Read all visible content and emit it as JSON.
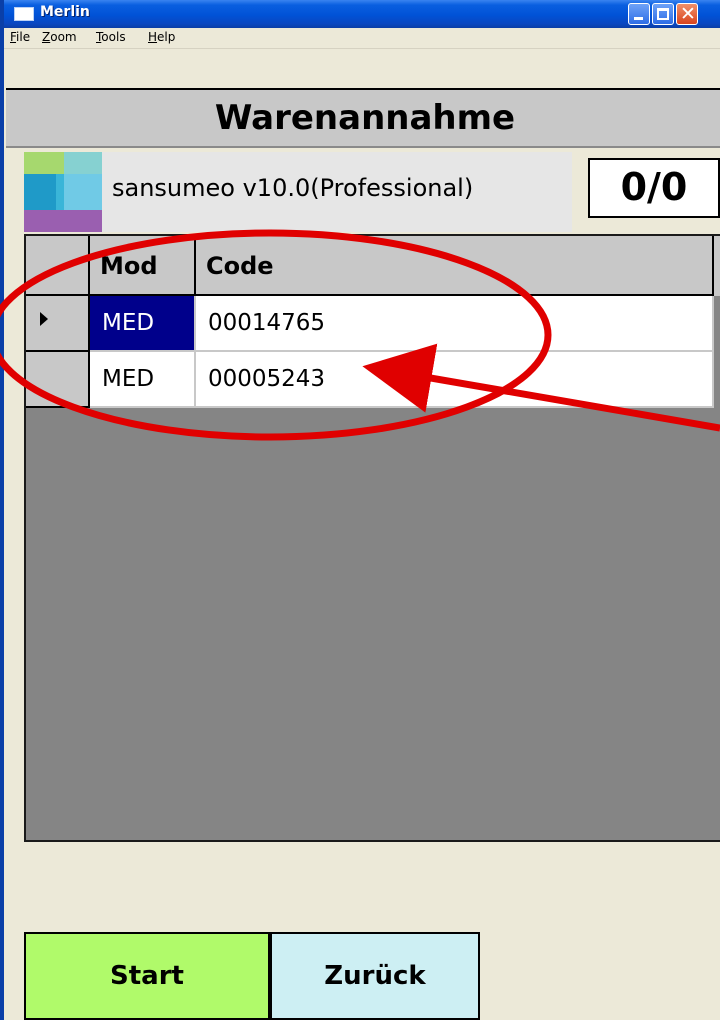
{
  "window": {
    "title": "Merlin",
    "controls": [
      "minimize-icon",
      "maximize-icon",
      "close-icon"
    ]
  },
  "menu": {
    "file": {
      "hotkey": "F",
      "rest": "ile"
    },
    "zoom": {
      "hotkey": "Z",
      "rest": "oom"
    },
    "tools": {
      "hotkey": "T",
      "rest": "ools"
    },
    "help": {
      "hotkey": "H",
      "rest": "elp"
    }
  },
  "header": {
    "title": "Warenannahme"
  },
  "info": {
    "version": "sansumeo v10.0(Professional)",
    "counter": "0/0"
  },
  "grid": {
    "columns": [
      "Mod",
      "Code"
    ],
    "rows": [
      {
        "mod": "MED",
        "code": "00014765",
        "current": true
      },
      {
        "mod": "MED",
        "code": "00005243",
        "current": false
      }
    ]
  },
  "buttons": {
    "start": "Start",
    "back": "Zurück"
  },
  "colors": {
    "title_bar": "#0052d6",
    "selection": "#00008b",
    "start_button": "#b0fa6a",
    "back_button": "#cdeff3",
    "annotation": "#e00000"
  }
}
